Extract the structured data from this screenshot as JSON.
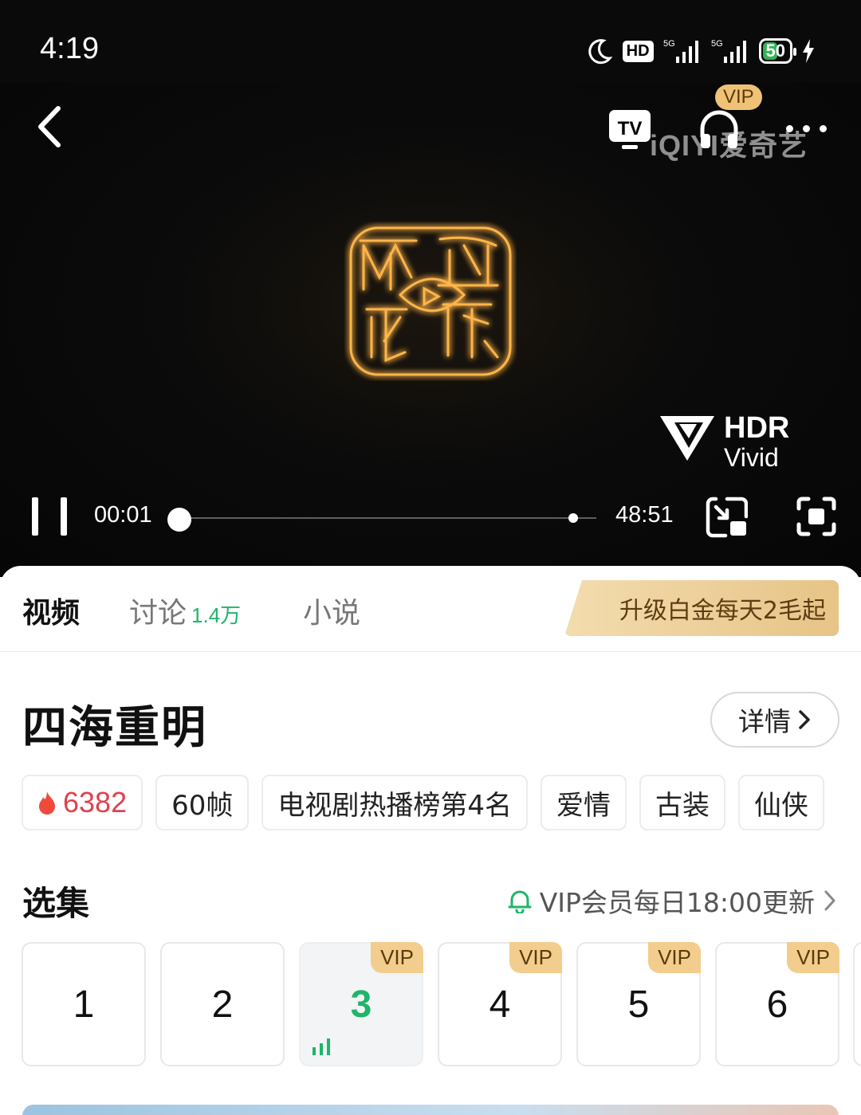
{
  "status_bar": {
    "time": "4:19",
    "hd_label": "HD",
    "signal_label_1": "5G",
    "signal_label_2": "5G",
    "battery_level": "50"
  },
  "player": {
    "watermark": "iQIYI爱奇艺",
    "vip_label": "VIP",
    "tv_label": "TV",
    "hdr_line1": "HDR",
    "hdr_line2": "Vivid",
    "current_time": "00:01",
    "duration": "48:51",
    "progress_fraction": 0.0003
  },
  "tabs": [
    {
      "label": "视频",
      "active": true
    },
    {
      "label": "讨论",
      "count": "1.4万"
    },
    {
      "label": "小说"
    }
  ],
  "upgrade_button": "升级白金每天2毛起",
  "show": {
    "title": "四海重明",
    "detail_button": "详情",
    "heat": "6382",
    "tags": [
      "60帧",
      "电视剧热播榜第4名",
      "爱情",
      "古装",
      "仙侠"
    ]
  },
  "episodes": {
    "heading": "选集",
    "update_note": "VIP会员每日18:00更新",
    "vip_badge": "VIP",
    "items": [
      {
        "number": "1",
        "vip": false
      },
      {
        "number": "2",
        "vip": false
      },
      {
        "number": "3",
        "vip": true,
        "current": true
      },
      {
        "number": "4",
        "vip": true
      },
      {
        "number": "5",
        "vip": true
      },
      {
        "number": "6",
        "vip": true
      }
    ]
  },
  "colors": {
    "accent_green": "#1fb56a",
    "heat_red": "#e0414f",
    "vip_gold": "#f3cd8d"
  }
}
